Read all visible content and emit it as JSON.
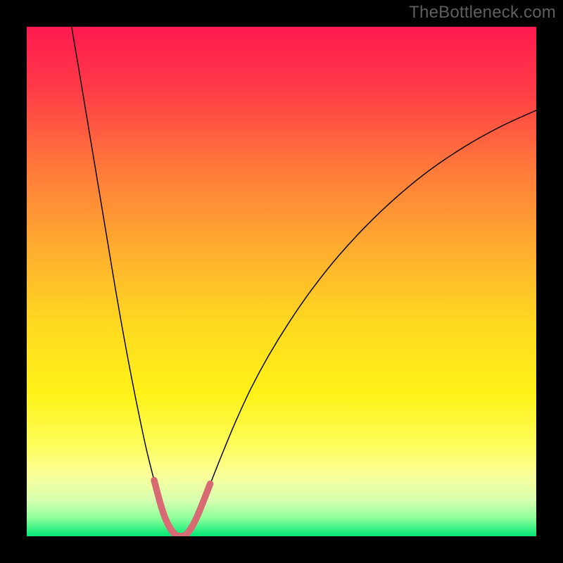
{
  "watermark": "TheBottleneck.com",
  "chart_data": {
    "type": "line",
    "title": "",
    "xlabel": "",
    "ylabel": "",
    "xlim": [
      0,
      1000
    ],
    "ylim": [
      0,
      1000
    ],
    "background_gradient": {
      "stops": [
        {
          "offset": 0.0,
          "color": "#ff1a50"
        },
        {
          "offset": 0.12,
          "color": "#ff3a48"
        },
        {
          "offset": 0.28,
          "color": "#ff7a3a"
        },
        {
          "offset": 0.44,
          "color": "#ffae2f"
        },
        {
          "offset": 0.58,
          "color": "#ffd820"
        },
        {
          "offset": 0.72,
          "color": "#fff218"
        },
        {
          "offset": 0.82,
          "color": "#fdfd59"
        },
        {
          "offset": 0.88,
          "color": "#faff9a"
        },
        {
          "offset": 0.93,
          "color": "#d6ffb0"
        },
        {
          "offset": 0.965,
          "color": "#8aff9a"
        },
        {
          "offset": 1.0,
          "color": "#00e874"
        }
      ]
    },
    "series": [
      {
        "name": "bottleneck-curve",
        "color": "#000000",
        "stroke_width": 2,
        "points": [
          {
            "x": 88,
            "y": 1000
          },
          {
            "x": 100,
            "y": 930
          },
          {
            "x": 115,
            "y": 840
          },
          {
            "x": 130,
            "y": 750
          },
          {
            "x": 145,
            "y": 660
          },
          {
            "x": 160,
            "y": 570
          },
          {
            "x": 175,
            "y": 480
          },
          {
            "x": 190,
            "y": 395
          },
          {
            "x": 205,
            "y": 315
          },
          {
            "x": 220,
            "y": 240
          },
          {
            "x": 235,
            "y": 170
          },
          {
            "x": 250,
            "y": 110
          },
          {
            "x": 262,
            "y": 65
          },
          {
            "x": 272,
            "y": 35
          },
          {
            "x": 282,
            "y": 15
          },
          {
            "x": 292,
            "y": 3
          },
          {
            "x": 302,
            "y": 0
          },
          {
            "x": 312,
            "y": 3
          },
          {
            "x": 322,
            "y": 15
          },
          {
            "x": 334,
            "y": 38
          },
          {
            "x": 348,
            "y": 72
          },
          {
            "x": 365,
            "y": 115
          },
          {
            "x": 385,
            "y": 165
          },
          {
            "x": 410,
            "y": 225
          },
          {
            "x": 440,
            "y": 290
          },
          {
            "x": 475,
            "y": 355
          },
          {
            "x": 515,
            "y": 420
          },
          {
            "x": 560,
            "y": 485
          },
          {
            "x": 610,
            "y": 548
          },
          {
            "x": 665,
            "y": 608
          },
          {
            "x": 725,
            "y": 665
          },
          {
            "x": 790,
            "y": 718
          },
          {
            "x": 860,
            "y": 765
          },
          {
            "x": 930,
            "y": 804
          },
          {
            "x": 1000,
            "y": 836
          }
        ]
      },
      {
        "name": "highlight-segment",
        "color": "#d86a73",
        "stroke_width": 13,
        "points": [
          {
            "x": 250,
            "y": 110
          },
          {
            "x": 262,
            "y": 65
          },
          {
            "x": 272,
            "y": 35
          },
          {
            "x": 282,
            "y": 15
          },
          {
            "x": 292,
            "y": 3
          },
          {
            "x": 302,
            "y": 0
          },
          {
            "x": 312,
            "y": 3
          },
          {
            "x": 322,
            "y": 15
          },
          {
            "x": 334,
            "y": 38
          },
          {
            "x": 348,
            "y": 72
          },
          {
            "x": 360,
            "y": 103
          }
        ]
      }
    ]
  }
}
